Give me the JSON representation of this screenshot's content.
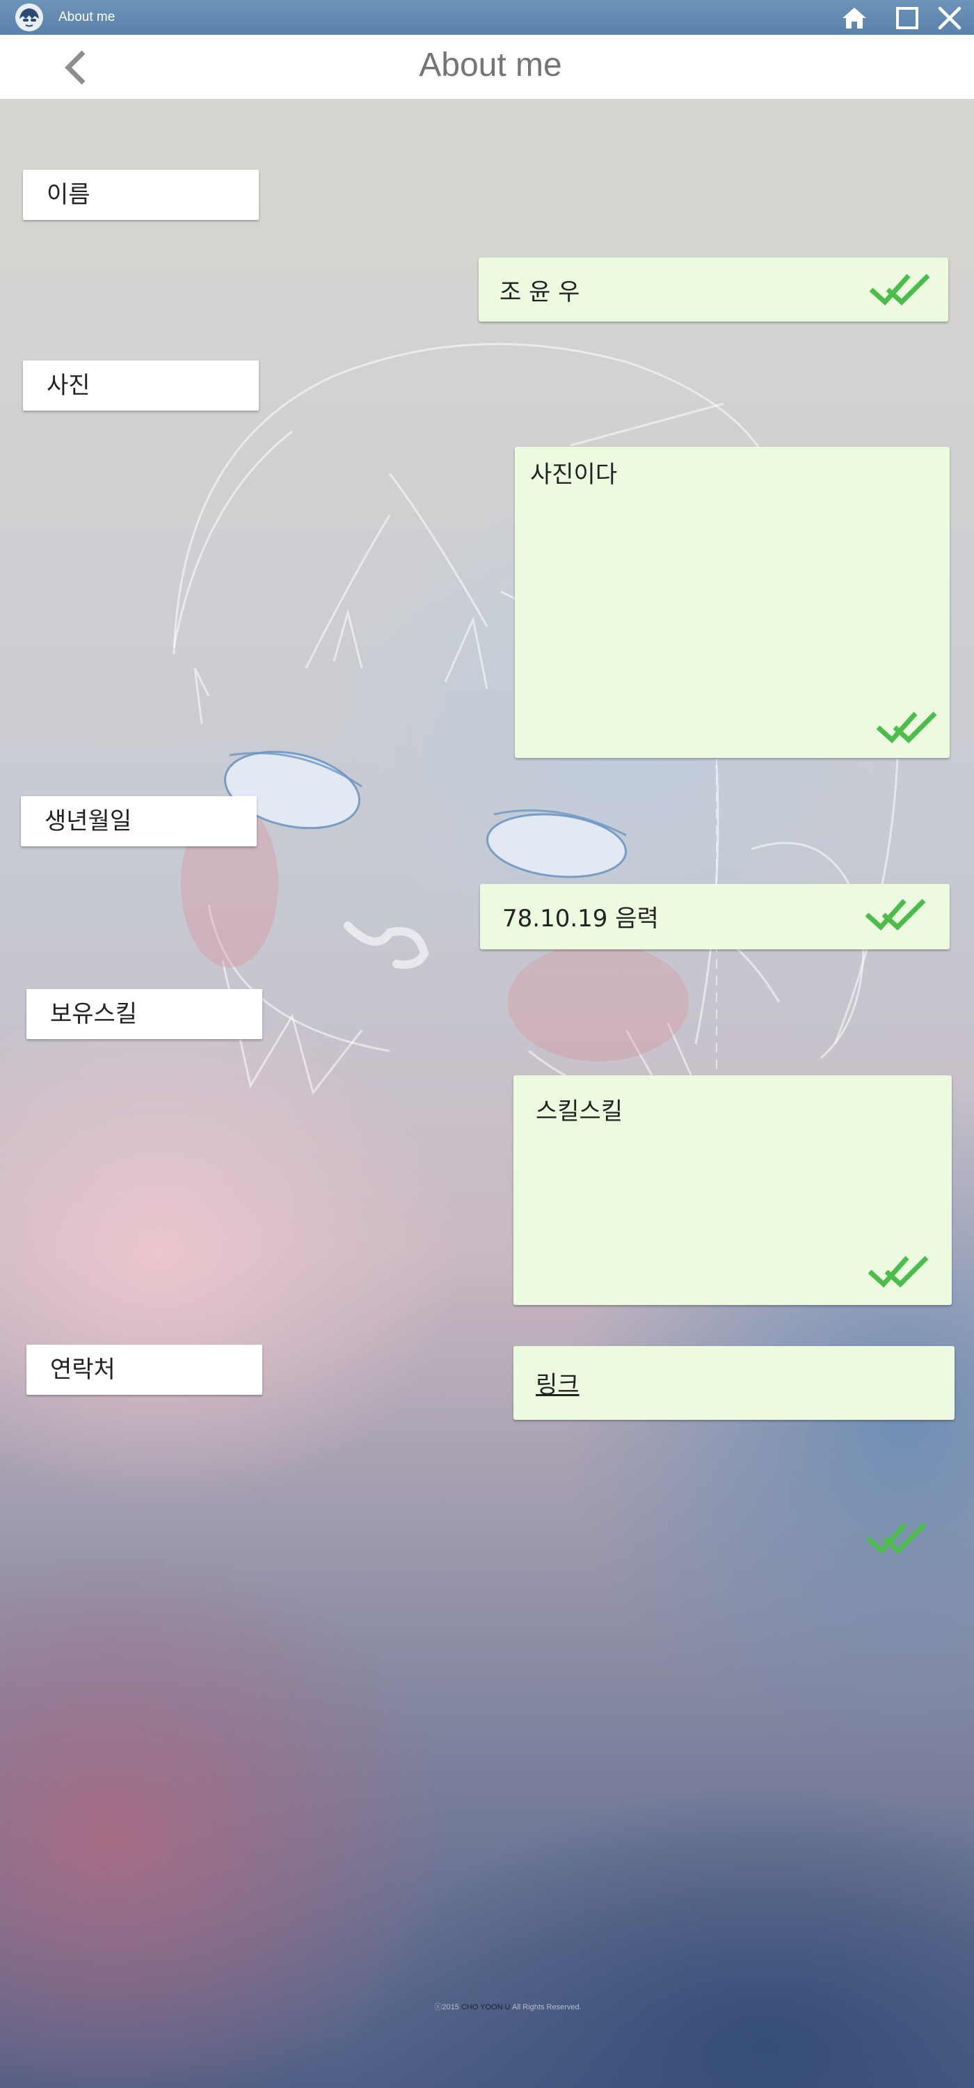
{
  "titlebar": {
    "title": "About me",
    "icons": [
      "app-avatar-icon",
      "home-icon",
      "maximize-icon",
      "close-icon"
    ]
  },
  "header": {
    "title": "About me",
    "back_icon": "chevron-left-icon"
  },
  "profile": [
    {
      "label": "이름",
      "value": "조 윤 우",
      "status_icon": "double-check-icon"
    },
    {
      "label": "사진",
      "value": "사진이다",
      "status_icon": "double-check-icon"
    },
    {
      "label": "생년월일",
      "value": "78.10.19 음력",
      "status_icon": "double-check-icon"
    },
    {
      "label": "보유스킬",
      "value": "스킬스킬",
      "status_icon": "double-check-icon"
    },
    {
      "label": "연락처",
      "value": "링크",
      "status_icon": "double-check-icon"
    }
  ],
  "footer": {
    "prefix": "ⓒ2015 ",
    "name": "CHO YOON U",
    "suffix": " All Rights Reserved."
  },
  "colors": {
    "titlebar": "#6d93b8",
    "value_bubble": "#ecfbdf",
    "label_bubble": "#ffffff",
    "check": "#4cbd4c",
    "title_text": "#757575"
  }
}
